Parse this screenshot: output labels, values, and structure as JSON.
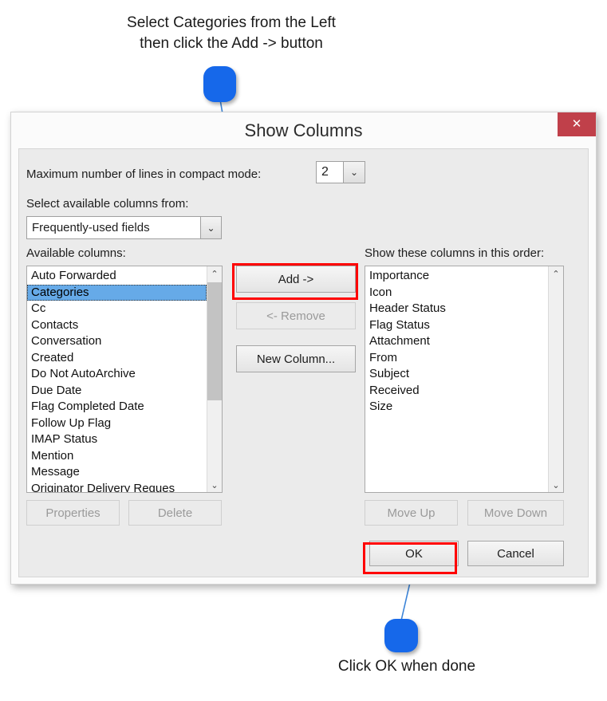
{
  "annotations": {
    "top": "Select Categories from the Left\nthen click the Add -> button",
    "bottom": "Click OK when done",
    "callout_color": "#1668ea",
    "highlight_color": "#ff0000"
  },
  "dialog": {
    "title": "Show Columns",
    "close_label": "✕",
    "max_lines": {
      "label": "Maximum number of lines in compact mode:",
      "value": "2",
      "arrow": "⌄"
    },
    "source_combo": {
      "label": "Select available columns from:",
      "value": "Frequently-used fields",
      "arrow": "⌄"
    },
    "available": {
      "label": "Available columns:",
      "items": [
        "Auto Forwarded",
        "Categories",
        "Cc",
        "Contacts",
        "Conversation",
        "Created",
        "Do Not AutoArchive",
        "Due Date",
        "Flag Completed Date",
        "Follow Up Flag",
        "IMAP Status",
        "Mention",
        "Message",
        "Originator Delivery Reques"
      ],
      "selected": "Categories",
      "scroll_up": "⌃",
      "scroll_down": "⌄"
    },
    "shown": {
      "label": "Show these columns in this order:",
      "items": [
        "Importance",
        "Icon",
        "Header Status",
        "Flag Status",
        "Attachment",
        "From",
        "Subject",
        "Received",
        "Size"
      ],
      "scroll_up": "⌃",
      "scroll_down": "⌄"
    },
    "buttons": {
      "add": "Add ->",
      "remove": "<- Remove",
      "new_column": "New Column...",
      "properties": "Properties",
      "delete": "Delete",
      "move_up": "Move Up",
      "move_down": "Move Down",
      "ok": "OK",
      "cancel": "Cancel"
    }
  }
}
